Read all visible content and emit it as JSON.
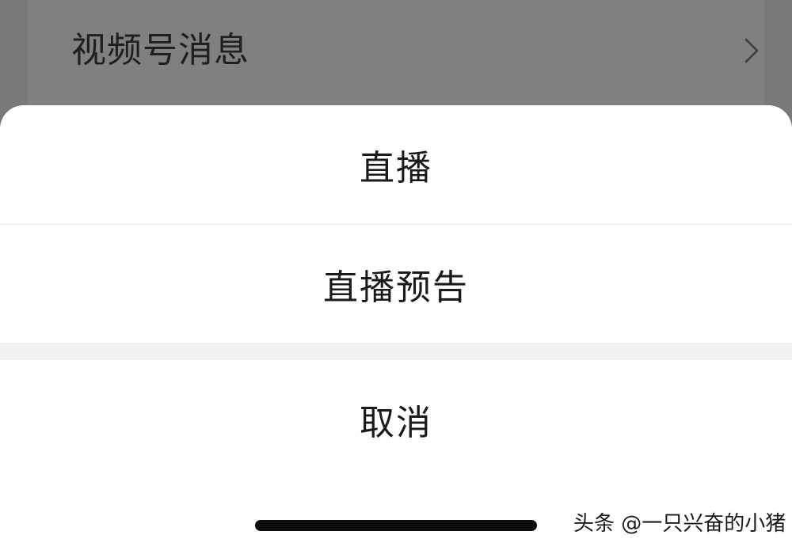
{
  "background": {
    "row_label": "视频号消息",
    "row_chevron_icon": "chevron-right-icon"
  },
  "action_sheet": {
    "options": [
      {
        "label": "直播"
      },
      {
        "label": "直播预告"
      }
    ],
    "cancel_label": "取消"
  },
  "watermark": "头条 @一只兴奋的小猪",
  "colors": {
    "overlay": "#7f7f7f",
    "sheet": "#ffffff",
    "gap": "#f0f0f0",
    "text": "#1a1a1a"
  }
}
